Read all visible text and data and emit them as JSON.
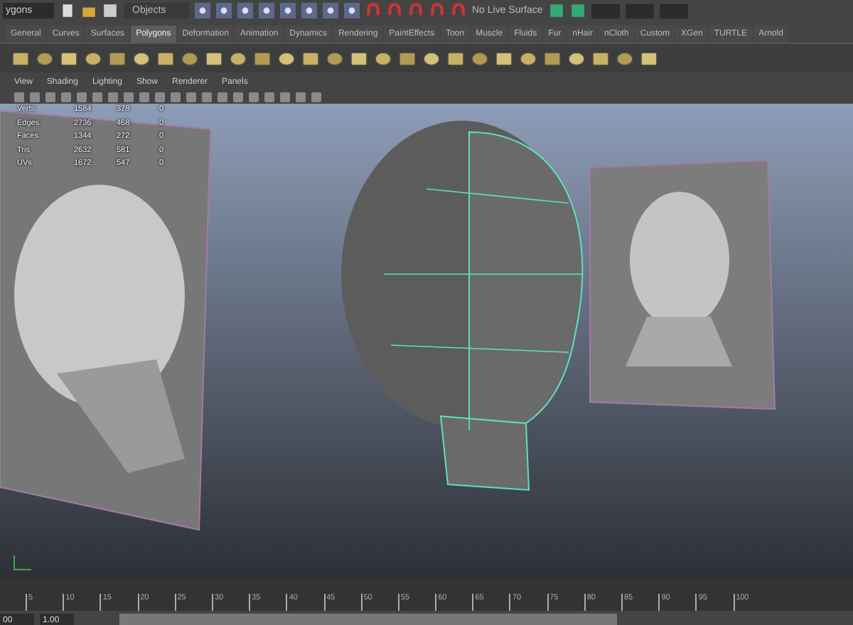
{
  "status_line": {
    "mode_menu": "ygons",
    "object_field": "Objects",
    "live_surface": "No Live Surface"
  },
  "shelf_tabs": [
    {
      "label": "General",
      "selected": false
    },
    {
      "label": "Curves",
      "selected": false
    },
    {
      "label": "Surfaces",
      "selected": false
    },
    {
      "label": "Polygons",
      "selected": true
    },
    {
      "label": "Deformation",
      "selected": false
    },
    {
      "label": "Animation",
      "selected": false
    },
    {
      "label": "Dynamics",
      "selected": false
    },
    {
      "label": "Rendering",
      "selected": false
    },
    {
      "label": "PaintEffects",
      "selected": false
    },
    {
      "label": "Toon",
      "selected": false
    },
    {
      "label": "Muscle",
      "selected": false
    },
    {
      "label": "Fluids",
      "selected": false
    },
    {
      "label": "Fur",
      "selected": false
    },
    {
      "label": "nHair",
      "selected": false
    },
    {
      "label": "nCloth",
      "selected": false
    },
    {
      "label": "Custom",
      "selected": false
    },
    {
      "label": "XGen",
      "selected": false
    },
    {
      "label": "TURTLE",
      "selected": false
    },
    {
      "label": "Arnold",
      "selected": false
    }
  ],
  "panel_menu": [
    "View",
    "Shading",
    "Lighting",
    "Show",
    "Renderer",
    "Panels"
  ],
  "hud_stats": [
    {
      "label": "Verts",
      "values": [
        "1584",
        "378",
        "0"
      ]
    },
    {
      "label": "Edges",
      "values": [
        "2736",
        "468",
        "0"
      ]
    },
    {
      "label": "Faces",
      "values": [
        "1344",
        "272",
        "0"
      ]
    },
    {
      "label": "Tris",
      "values": [
        "2632",
        "581",
        "0"
      ]
    },
    {
      "label": "UVs",
      "values": [
        "1672",
        "547",
        "0"
      ]
    }
  ],
  "time_slider": {
    "ticks": [
      "5",
      "10",
      "15",
      "20",
      "25",
      "30",
      "35",
      "40",
      "45",
      "50",
      "55",
      "60",
      "65",
      "70",
      "75",
      "80",
      "85",
      "90",
      "95",
      "100"
    ]
  },
  "range_slider": {
    "start_field": "00",
    "current_field": "1.00"
  }
}
